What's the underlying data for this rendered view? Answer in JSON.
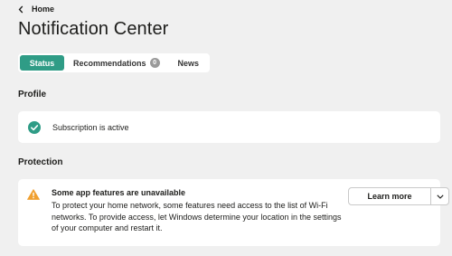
{
  "nav": {
    "back_label": "Home"
  },
  "page": {
    "title": "Notification Center"
  },
  "tabs": [
    {
      "label": "Status",
      "active": true
    },
    {
      "label": "Recommendations",
      "badge": "0"
    },
    {
      "label": "News"
    }
  ],
  "profile": {
    "heading": "Profile",
    "status_text": "Subscription is active"
  },
  "protection": {
    "heading": "Protection",
    "alert_title": "Some app features are unavailable",
    "alert_body": "To protect your home network, some features need access to the list of Wi-Fi networks. To provide access, let Windows determine your location in the settings of your computer and restart it.",
    "action_label": "Learn more"
  },
  "colors": {
    "accent": "#2f9c86",
    "success": "#2f9c86",
    "warning": "#f0a030",
    "background": "#f0f0f0"
  },
  "icons": [
    "chevron-left-icon",
    "check-circle-icon",
    "warning-icon",
    "chevron-down-icon"
  ]
}
